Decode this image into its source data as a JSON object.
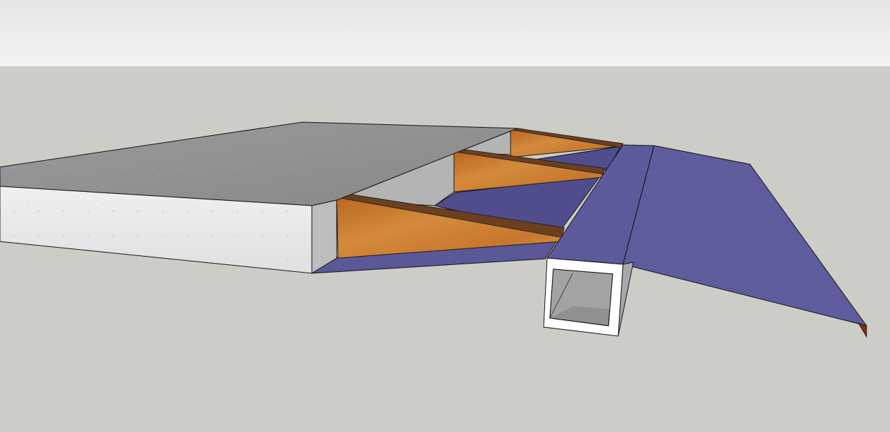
{
  "scene": {
    "objects": [
      "concrete-slab",
      "wood-joists",
      "eave-membrane",
      "rectangular-tube-beam",
      "drip-edge"
    ]
  },
  "colors": {
    "sky": "#edefef",
    "ground": "#cdcdc8",
    "concrete_top": "#8f8f8f",
    "concrete_side": "#e9e9e9",
    "membrane": "#5c5a9a",
    "wood": "#c8782e",
    "wood_edge": "#6b4020",
    "tube_frame": "#ffffff",
    "tube_interior": "#8e8e8e",
    "drip_edge": "#8a2a12"
  }
}
